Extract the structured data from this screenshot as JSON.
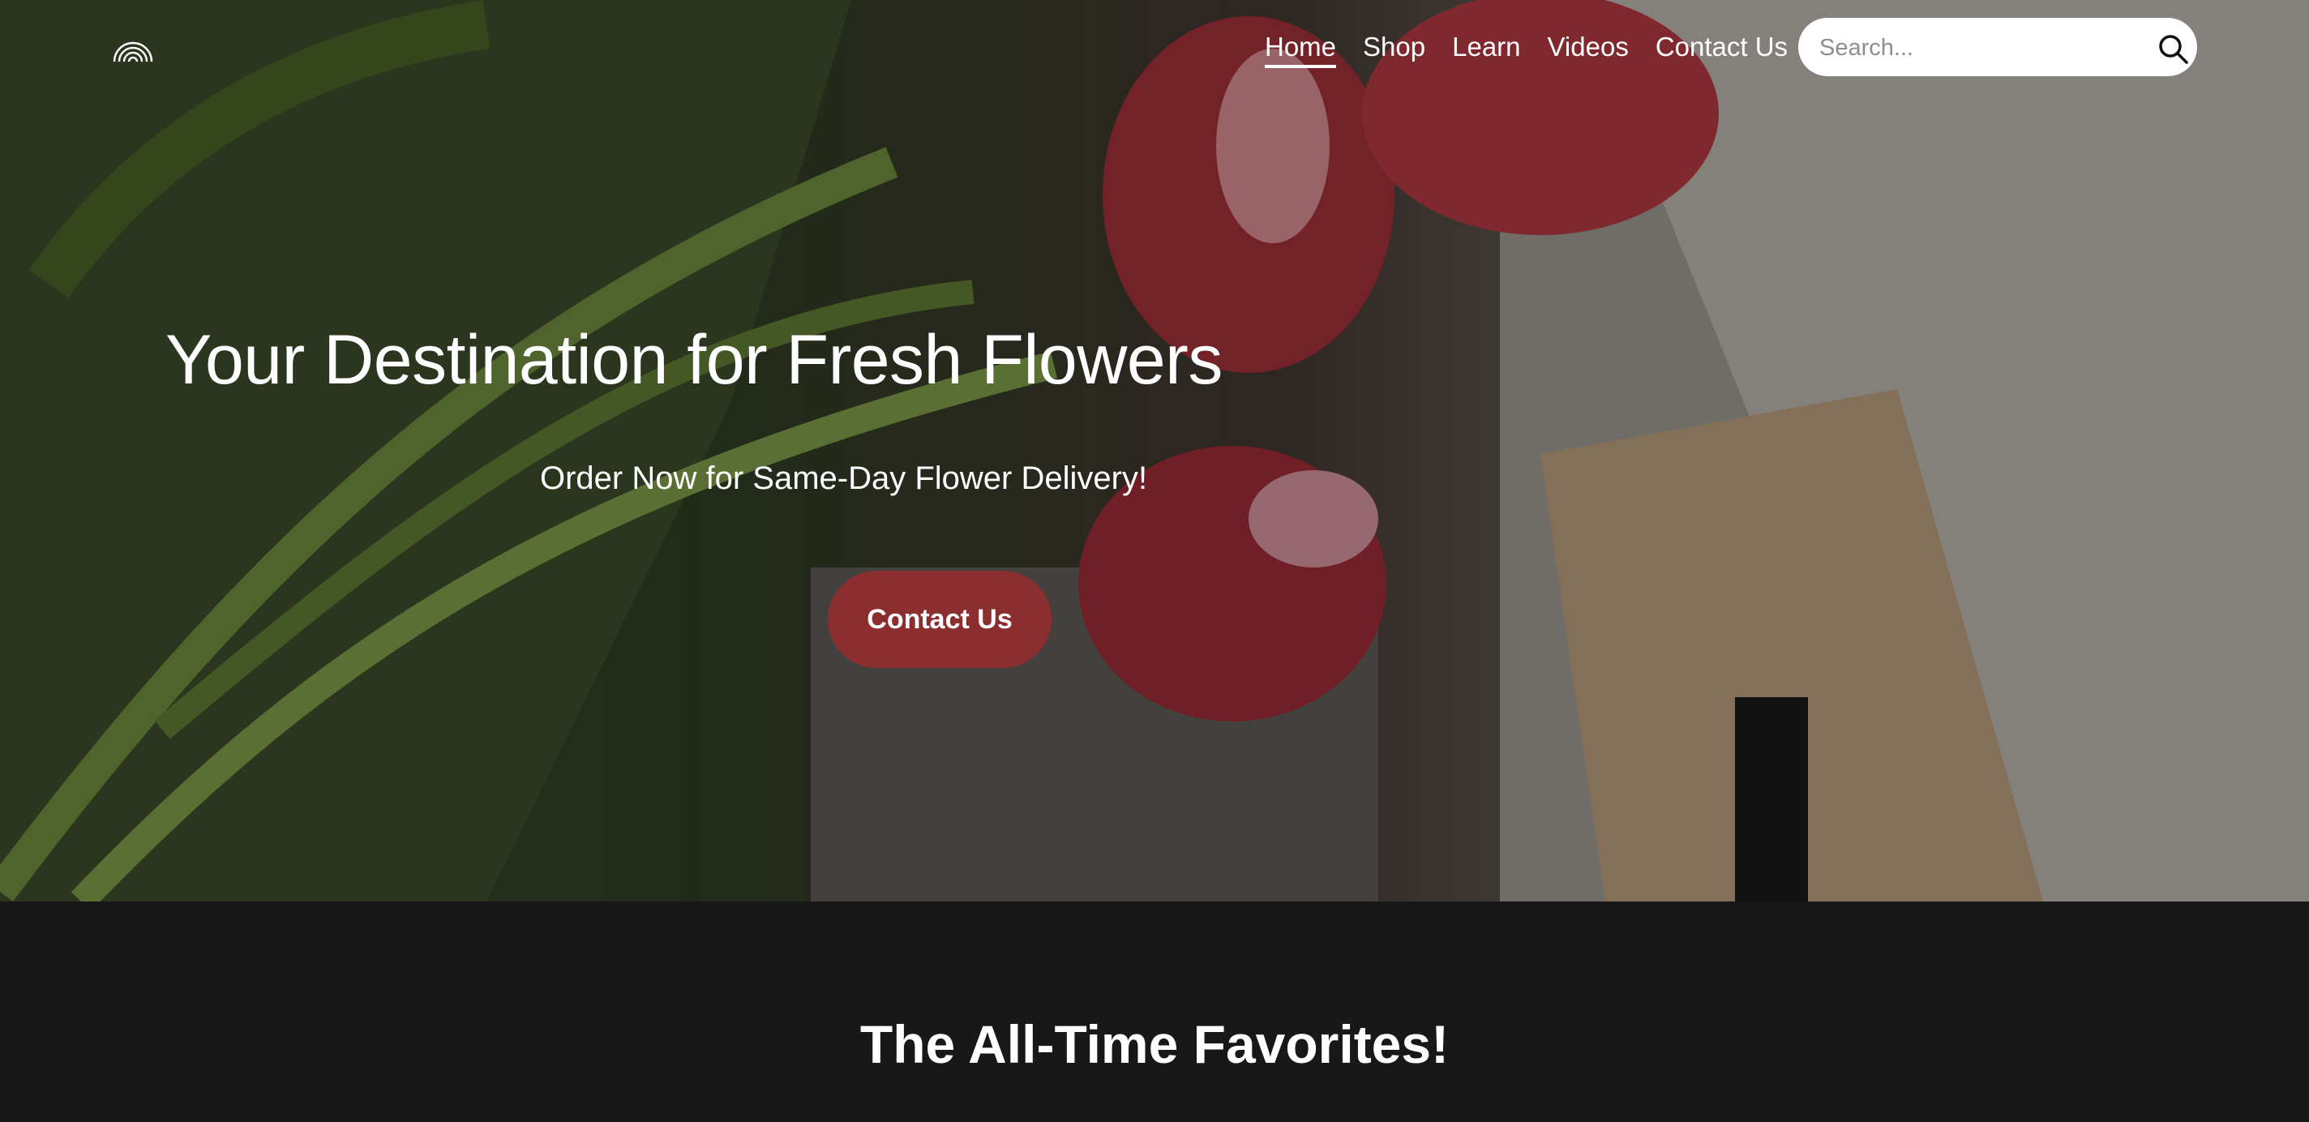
{
  "header": {
    "logo_icon": "rainbow-arcs-logo",
    "nav": [
      {
        "label": "Home",
        "active": true
      },
      {
        "label": "Shop",
        "active": false
      },
      {
        "label": "Learn",
        "active": false
      },
      {
        "label": "Videos",
        "active": false
      },
      {
        "label": "Contact Us",
        "active": false
      }
    ],
    "search": {
      "placeholder": "Search...",
      "value": "",
      "icon": "search-icon"
    }
  },
  "hero": {
    "title": "Your Destination for Fresh Flowers",
    "subtitle": "Order Now for Same-Day Flower Delivery!",
    "cta_label": "Contact Us"
  },
  "favorites": {
    "title": "The All-Time Favorites!"
  },
  "colors": {
    "accent": "#8b2e30",
    "dark_bg": "#181818",
    "text": "#ffffff"
  }
}
